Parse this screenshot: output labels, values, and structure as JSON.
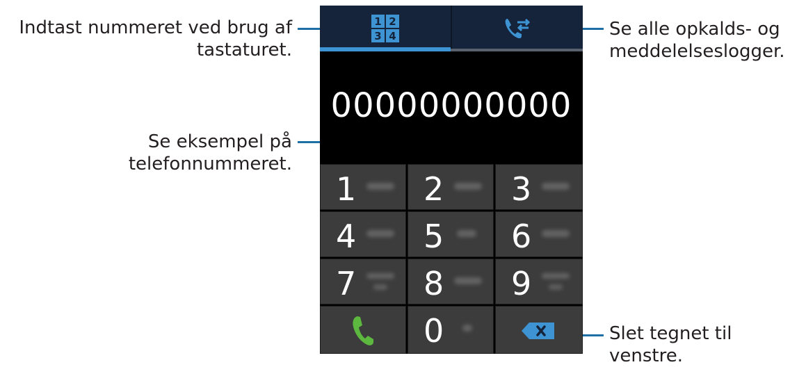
{
  "callouts": {
    "keypad_tab": "Indtast nummeret ved brug af tastaturet.",
    "keypad_tab_line1": "Indtast nummeret ved brug af",
    "keypad_tab_line2": "tastaturet.",
    "logs_tab_line1": "Se alle opkalds- og",
    "logs_tab_line2": "meddelelseslogger.",
    "number_preview": "Se eksempel på telefonnummeret.",
    "backspace": "Slet tegnet til venstre."
  },
  "tabs": [
    {
      "name": "keypad",
      "icon": "keypad-icon",
      "glyphs": [
        "1",
        "2",
        "3",
        "4"
      ],
      "active": true
    },
    {
      "name": "logs",
      "icon": "call-log-icon",
      "active": false
    }
  ],
  "number": "00000000000",
  "keys": [
    {
      "digit": "1"
    },
    {
      "digit": "2"
    },
    {
      "digit": "3"
    },
    {
      "digit": "4"
    },
    {
      "digit": "5"
    },
    {
      "digit": "6"
    },
    {
      "digit": "7"
    },
    {
      "digit": "8"
    },
    {
      "digit": "9"
    },
    {
      "digit": "call",
      "icon": "call-icon"
    },
    {
      "digit": "0"
    },
    {
      "digit": "delete",
      "icon": "backspace-icon"
    }
  ],
  "colors": {
    "accent": "#3e93d3",
    "tabbar": "#15243b",
    "call_green": "#5cb83f",
    "backspace_blue": "#3e93d3",
    "leader": "#1d6fa5"
  }
}
